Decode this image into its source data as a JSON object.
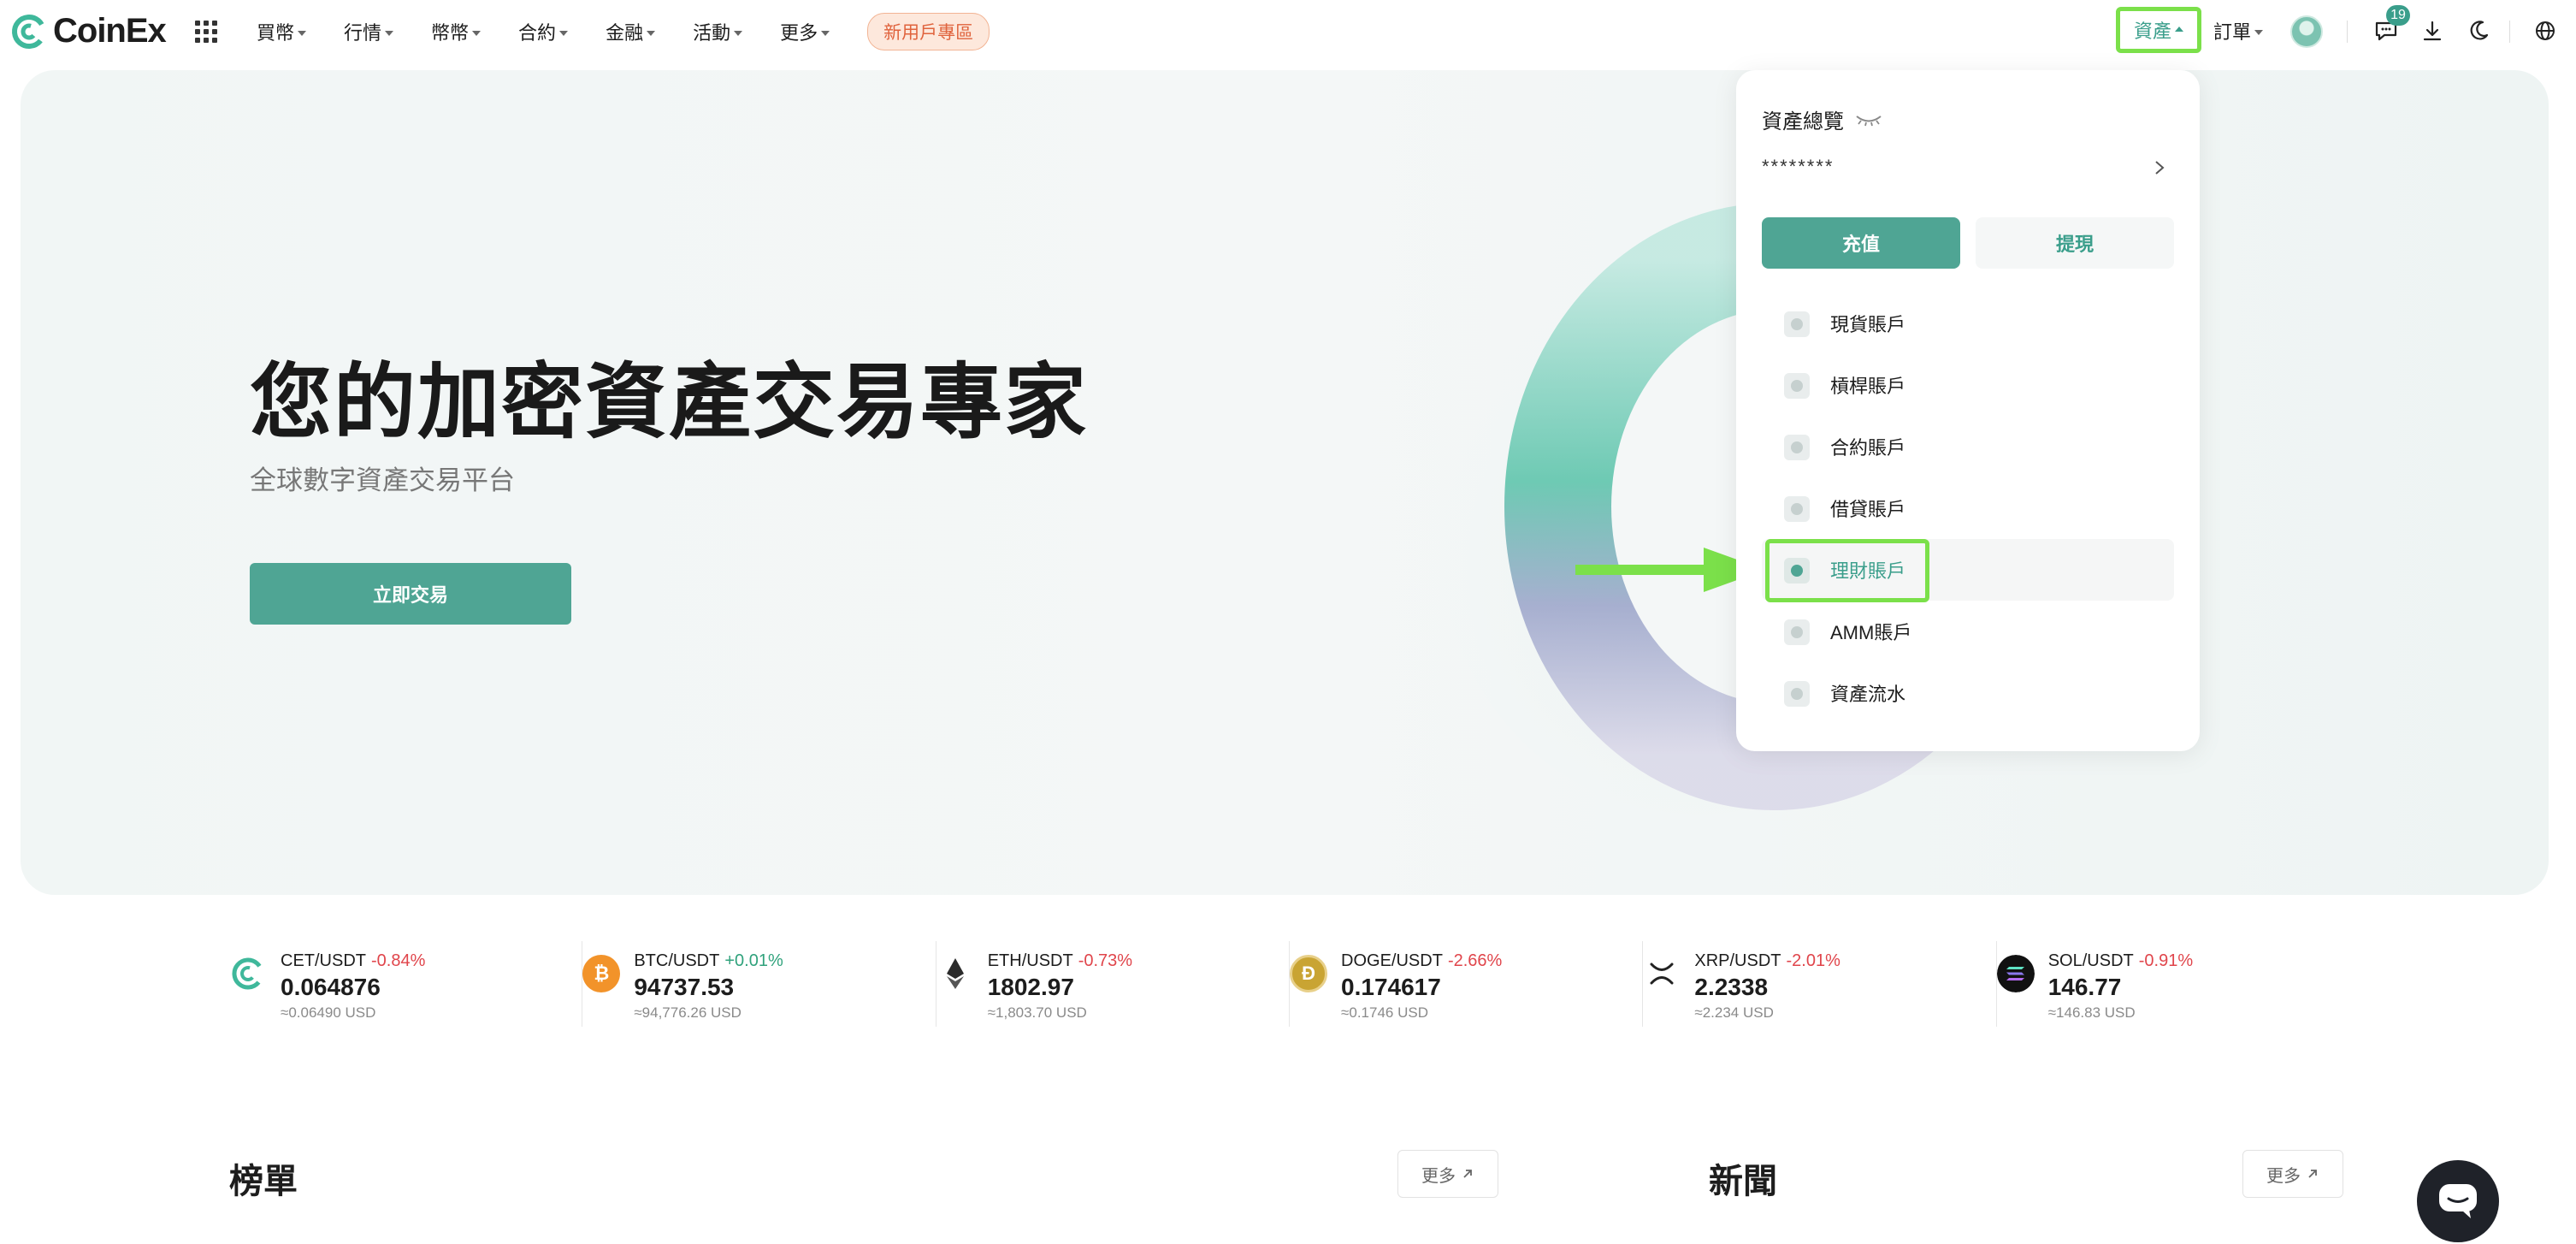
{
  "brand": {
    "name": "CoinEx",
    "accent": "#4fa594",
    "highlight": "#7be04a"
  },
  "nav": {
    "items": [
      {
        "label": "買幣",
        "name": "nav-buy-crypto"
      },
      {
        "label": "行情",
        "name": "nav-markets"
      },
      {
        "label": "幣幣",
        "name": "nav-spot"
      },
      {
        "label": "合約",
        "name": "nav-futures"
      },
      {
        "label": "金融",
        "name": "nav-finance"
      },
      {
        "label": "活動",
        "name": "nav-activities"
      },
      {
        "label": "更多",
        "name": "nav-more"
      }
    ],
    "new_user_label": "新用戶專區",
    "assets_label": "資產",
    "orders_label": "訂單",
    "message_count": "19"
  },
  "hero": {
    "title": "您的加密資產交易專家",
    "subtitle": "全球數字資產交易平台",
    "cta_label": "立即交易"
  },
  "assets_dropdown": {
    "title": "資產總覽",
    "balance": "********",
    "deposit_label": "充值",
    "withdraw_label": "提現",
    "items": [
      {
        "label": "現貨賬戶",
        "name": "menu-spot-account",
        "icon": "spot-account-icon"
      },
      {
        "label": "槓桿賬戶",
        "name": "menu-margin-account",
        "icon": "margin-account-icon"
      },
      {
        "label": "合約賬戶",
        "name": "menu-futures-account",
        "icon": "futures-account-icon"
      },
      {
        "label": "借貸賬戶",
        "name": "menu-loan-account",
        "icon": "loan-account-icon"
      },
      {
        "label": "理財賬戶",
        "name": "menu-financial-account",
        "icon": "financial-account-icon",
        "active": true
      },
      {
        "label": "AMM賬戶",
        "name": "menu-amm-account",
        "icon": "amm-account-icon"
      },
      {
        "label": "資產流水",
        "name": "menu-asset-history",
        "icon": "asset-history-icon"
      }
    ]
  },
  "tickers": [
    {
      "pair": "CET/USDT",
      "change": "-0.84%",
      "dir": "down",
      "price": "0.064876",
      "usd": "≈0.06490 USD",
      "icon": "cet-coin-icon",
      "color": "#ffffff"
    },
    {
      "pair": "BTC/USDT",
      "change": "+0.01%",
      "dir": "up",
      "price": "94737.53",
      "usd": "≈94,776.26 USD",
      "icon": "btc-coin-icon",
      "color": "#f2932a"
    },
    {
      "pair": "ETH/USDT",
      "change": "-0.73%",
      "dir": "down",
      "price": "1802.97",
      "usd": "≈1,803.70 USD",
      "icon": "eth-coin-icon",
      "color": "#ffffff"
    },
    {
      "pair": "DOGE/USDT",
      "change": "-2.66%",
      "dir": "down",
      "price": "0.174617",
      "usd": "≈0.1746 USD",
      "icon": "doge-coin-icon",
      "color": "#c9a433"
    },
    {
      "pair": "XRP/USDT",
      "change": "-2.01%",
      "dir": "down",
      "price": "2.2338",
      "usd": "≈2.234 USD",
      "icon": "xrp-coin-icon",
      "color": "#ffffff"
    },
    {
      "pair": "SOL/USDT",
      "change": "-0.91%",
      "dir": "down",
      "price": "146.77",
      "usd": "≈146.83 USD",
      "icon": "sol-coin-icon",
      "color": "#111111"
    }
  ],
  "sections": {
    "rankings_title": "榜單",
    "news_title": "新聞",
    "more_label": "更多"
  }
}
